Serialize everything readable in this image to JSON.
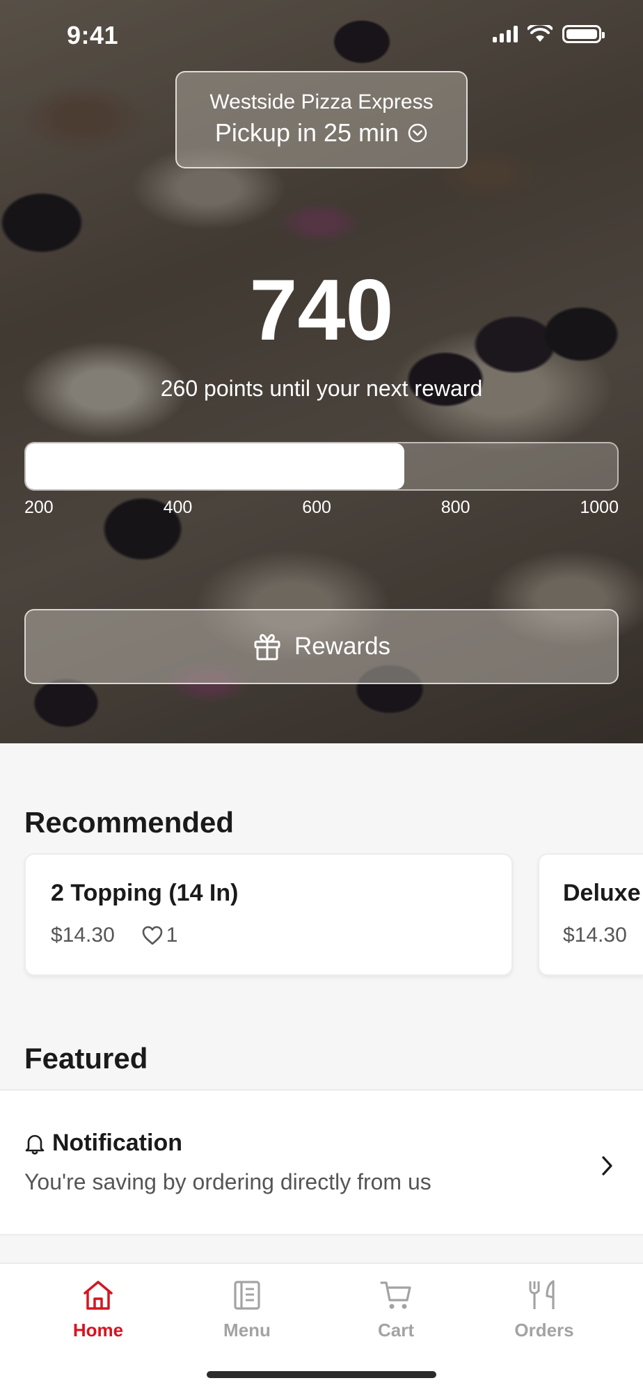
{
  "status_bar": {
    "time": "9:41"
  },
  "store": {
    "name": "Westside Pizza Express",
    "pickup": "Pickup in 25 min"
  },
  "rewards": {
    "points": "740",
    "subtitle": "260 points until your next reward",
    "progress_fraction": 0.64,
    "ticks": [
      "200",
      "400",
      "600",
      "800",
      "1000"
    ],
    "button_label": "Rewards"
  },
  "recommended": {
    "title": "Recommended",
    "items": [
      {
        "name": "2 Topping (14 In)",
        "price": "$14.30",
        "likes": "1"
      },
      {
        "name": "Deluxe",
        "price": "$14.30"
      }
    ]
  },
  "featured": {
    "title": "Featured",
    "notification_title": "Notification",
    "notification_body": "You're saving by ordering directly from us"
  },
  "tabs": [
    {
      "label": "Home",
      "icon": "home-icon",
      "active": true
    },
    {
      "label": "Menu",
      "icon": "menu-icon",
      "active": false
    },
    {
      "label": "Cart",
      "icon": "cart-icon",
      "active": false
    },
    {
      "label": "Orders",
      "icon": "orders-icon",
      "active": false
    }
  ],
  "colors": {
    "accent": "#d7141e",
    "inactive_tab": "#a3a3a3",
    "background": "#f6f6f6"
  }
}
